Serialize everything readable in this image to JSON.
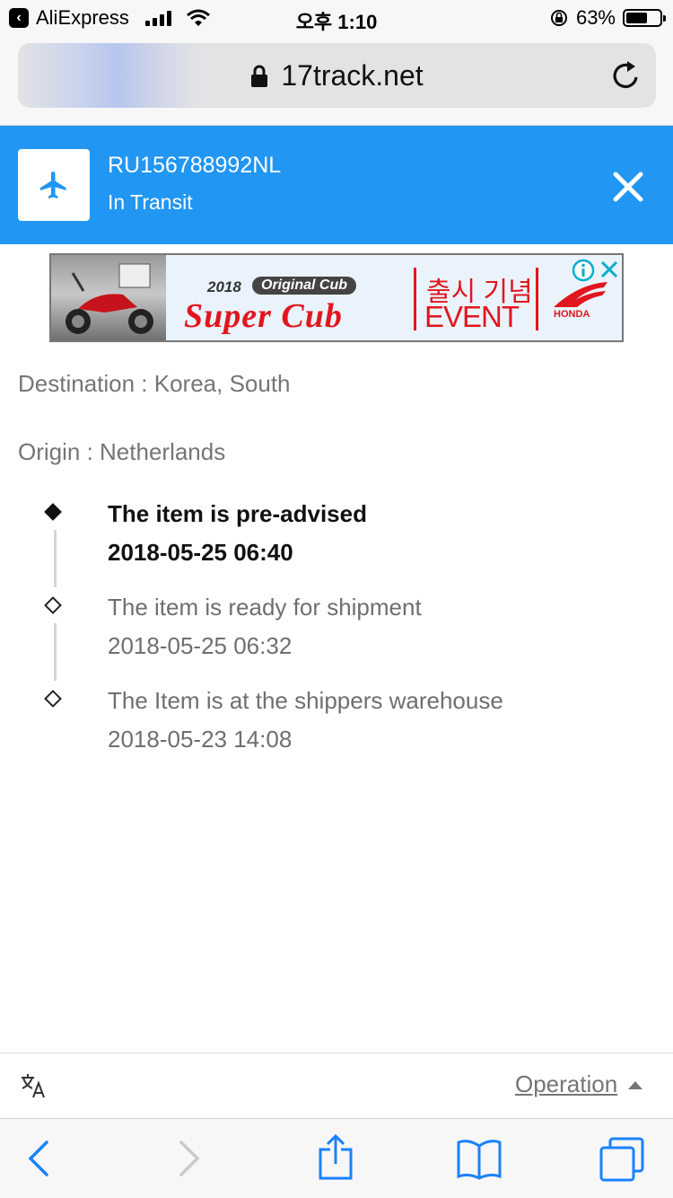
{
  "status_bar": {
    "back_app": "AliExpress",
    "time": "오후 1:10",
    "battery": "63%",
    "battery_level": 0.63
  },
  "browser": {
    "url": "17track.net"
  },
  "tracking": {
    "number": "RU156788992NL",
    "status": "In Transit",
    "icon": "airplane-icon"
  },
  "ad": {
    "year": "2018",
    "pill": "Original Cub",
    "headline": "Super Cub",
    "korean": "출시 기념",
    "event": "EVENT",
    "brand": "HONDA"
  },
  "shipment": {
    "destination": "Destination : Korea, South",
    "origin": "Origin : Netherlands"
  },
  "events": [
    {
      "title": "The item is pre-advised",
      "time": "2018-05-25 06:40",
      "current": true
    },
    {
      "title": "The item is ready for shipment",
      "time": "2018-05-25 06:32",
      "current": false
    },
    {
      "title": "The Item is at the shippers warehouse",
      "time": "2018-05-23 14:08",
      "current": false
    }
  ],
  "footer": {
    "operation": "Operation"
  },
  "colors": {
    "header_blue": "#2196f3",
    "ios_blue": "#1a82fb",
    "ad_red": "#e2161f",
    "muted_text": "#757575"
  }
}
